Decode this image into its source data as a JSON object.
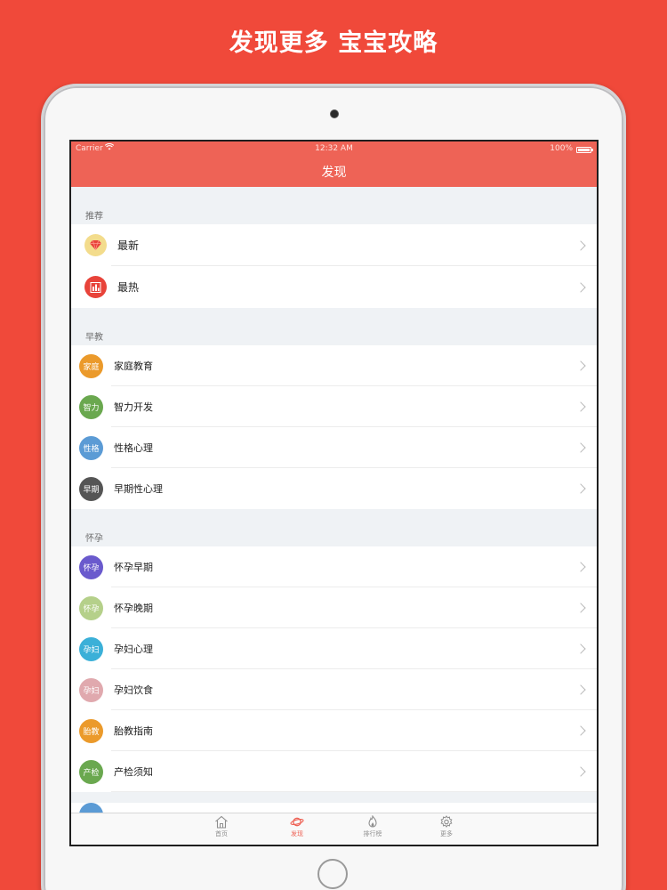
{
  "headline": "发现更多 宝宝攻略",
  "status_bar": {
    "carrier": "Carrier",
    "time": "12:32 AM",
    "battery": "100%"
  },
  "nav": {
    "title": "发现"
  },
  "sections": [
    {
      "header": "推荐",
      "items": [
        {
          "label": "最新",
          "icon": "diamond-icon"
        },
        {
          "label": "最热",
          "icon": "bar-chart-icon"
        }
      ]
    },
    {
      "header": "早教",
      "items": [
        {
          "label": "家庭教育",
          "badge": "家庭",
          "color": "#eb9a2b"
        },
        {
          "label": "智力开发",
          "badge": "智力",
          "color": "#6aa84f"
        },
        {
          "label": "性格心理",
          "badge": "性格",
          "color": "#5b9bd5"
        },
        {
          "label": "早期性心理",
          "badge": "早期",
          "color": "#555555"
        }
      ]
    },
    {
      "header": "怀孕",
      "items": [
        {
          "label": "怀孕早期",
          "badge": "怀孕",
          "color": "#6a5acd"
        },
        {
          "label": "怀孕晚期",
          "badge": "怀孕",
          "color": "#b5d08a"
        },
        {
          "label": "孕妇心理",
          "badge": "孕妇",
          "color": "#3bb0d8"
        },
        {
          "label": "孕妇饮食",
          "badge": "孕妇",
          "color": "#e0a9ae"
        },
        {
          "label": "胎教指南",
          "badge": "胎教",
          "color": "#eb9a2b"
        },
        {
          "label": "产检须知",
          "badge": "产检",
          "color": "#6aa84f"
        }
      ]
    }
  ],
  "partial_row": {
    "color": "#5b9bd5"
  },
  "tabs": [
    {
      "label": "首页",
      "icon": "home-icon"
    },
    {
      "label": "发现",
      "icon": "planet-icon"
    },
    {
      "label": "排行榜",
      "icon": "flame-icon"
    },
    {
      "label": "更多",
      "icon": "gear-icon"
    }
  ],
  "colors": {
    "brand": "#f0493a",
    "nav": "#ee6356"
  }
}
